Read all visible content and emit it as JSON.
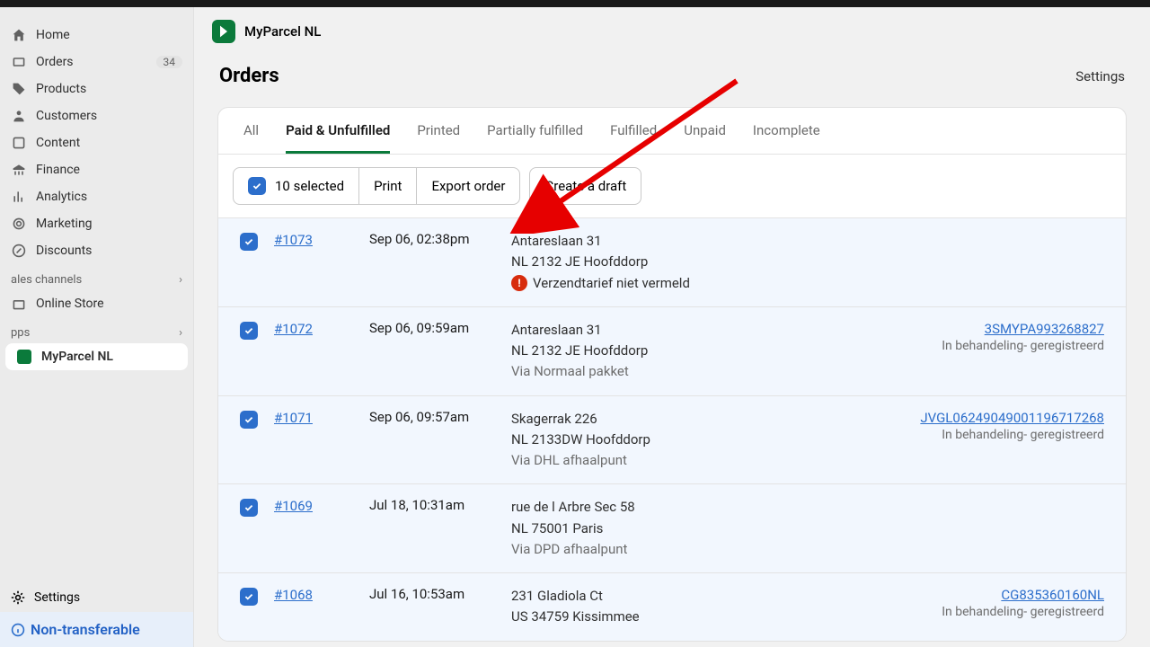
{
  "sidebar": {
    "home": "Home",
    "orders": "Orders",
    "orders_badge": "34",
    "products": "Products",
    "customers": "Customers",
    "content": "Content",
    "finance": "Finance",
    "analytics": "Analytics",
    "marketing": "Marketing",
    "discounts": "Discounts",
    "section_channels": "ales channels",
    "online_store": "Online Store",
    "section_apps": "pps",
    "myparcel": "MyParcel NL",
    "settings": "Settings",
    "nontransferable": "Non-transferable"
  },
  "appbar": {
    "title": "MyParcel NL"
  },
  "page": {
    "title": "Orders",
    "settings": "Settings"
  },
  "tabs": {
    "all": "All",
    "paid": "Paid & Unfulfilled",
    "printed": "Printed",
    "partially": "Partially fulfilled",
    "fulfilled": "Fulfilled",
    "unpaid": "Unpaid",
    "incomplete": "Incomplete"
  },
  "toolbar": {
    "selected": "10 selected",
    "print": "Print",
    "export": "Export order",
    "draft": "Create a draft"
  },
  "rows": [
    {
      "order": "#1073",
      "date": "Sep 06, 02:38pm",
      "addr1": "Antareslaan 31",
      "addr2": "NL 2132 JE Hoofddorp",
      "via": "",
      "warn": "Verzendtarief niet vermeld",
      "tracking": "",
      "status": ""
    },
    {
      "order": "#1072",
      "date": "Sep 06, 09:59am",
      "addr1": "Antareslaan 31",
      "addr2": "NL 2132 JE Hoofddorp",
      "via": "Via Normaal pakket",
      "warn": "",
      "tracking": "3SMYPA993268827",
      "status": "In behandeling- geregistreerd"
    },
    {
      "order": "#1071",
      "date": "Sep 06, 09:57am",
      "addr1": "Skagerrak 226",
      "addr2": "NL 2133DW Hoofddorp",
      "via": "Via DHL afhaalpunt",
      "warn": "",
      "tracking": "JVGL06249049001196717268",
      "status": "In behandeling- geregistreerd"
    },
    {
      "order": "#1069",
      "date": "Jul 18, 10:31am",
      "addr1": "rue de l Arbre Sec 58",
      "addr2": "NL 75001 Paris",
      "via": "Via DPD afhaalpunt",
      "warn": "",
      "tracking": "",
      "status": ""
    },
    {
      "order": "#1068",
      "date": "Jul 16, 10:53am",
      "addr1": "231 Gladiola Ct",
      "addr2": "US 34759 Kissimmee",
      "via": "",
      "warn": "",
      "tracking": "CG835360160NL",
      "status": "In behandeling- geregistreerd"
    }
  ]
}
